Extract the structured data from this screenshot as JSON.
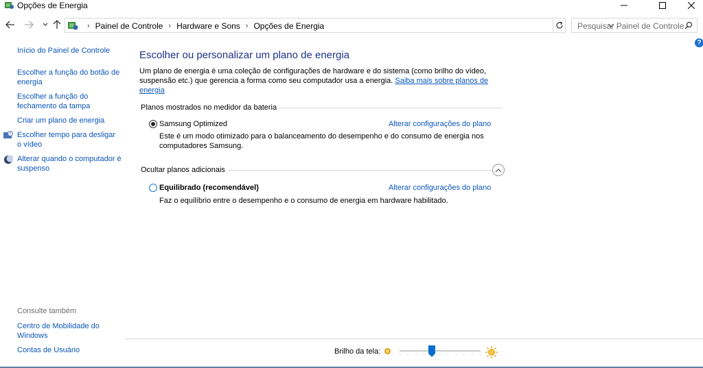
{
  "window": {
    "title": "Opções de Energia"
  },
  "address": {
    "breadcrumbs": [
      "Painel de Controle",
      "Hardware e Sons",
      "Opções de Energia"
    ],
    "search_placeholder": "Pesquisar Painel de Controle"
  },
  "sidebar": {
    "home": "Início do Painel de Controle",
    "items": [
      "Escolher a função do botão de energia",
      "Escolher a função do fechamento da tampa",
      "Criar um plano de energia",
      "Escolher tempo para desligar o vídeo",
      "Alterar quando o computador é suspenso"
    ],
    "see_also_label": "Consulte também",
    "see_also": [
      "Centro de Mobilidade do Windows",
      "Contas de Usuário"
    ]
  },
  "main": {
    "title": "Escolher ou personalizar um plano de energia",
    "description": "Um plano de energia é uma coleção de configurações de hardware e do sistema (como brilho do vídeo, suspensão etc.) que gerencia a forma como seu computador usa a energia.",
    "learn_more": "Saiba mais sobre planos de energia",
    "battery_section": "Planos mostrados no medidor da bateria",
    "additional_section": "Ocultar planos adicionais",
    "plans": [
      {
        "name": "Samsung Optimized",
        "selected": true,
        "change_link": "Alterar configurações do plano",
        "description": "Este é um modo otimizado para o balanceamento do desempenho e do consumo de energia nos computadores Samsung."
      },
      {
        "name": "Equilibrado (recomendável)",
        "selected": false,
        "change_link": "Alterar configurações do plano",
        "description": "Faz o equilíbrio entre o desempenho e o consumo de energia em hardware habilitado."
      }
    ]
  },
  "brightness": {
    "label": "Brilho da tela:",
    "level_percent": 40
  },
  "colors": {
    "link": "#0b55b8",
    "title": "#1e3287",
    "accent": "#0a6fd0"
  }
}
